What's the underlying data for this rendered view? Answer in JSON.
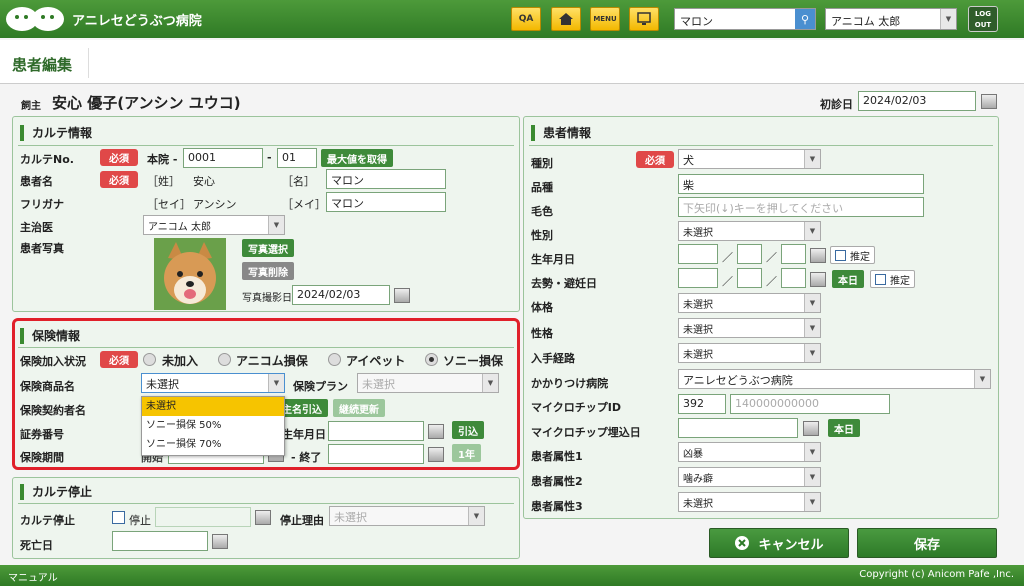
{
  "app": {
    "title": "アニレセどうぶつ病院",
    "search_value": "マロン",
    "user": "アニコム 太郎",
    "logout": "LOG OUT"
  },
  "toolbar": {
    "qa": "QA",
    "menu": "MENU"
  },
  "page": {
    "title": "患者編集"
  },
  "owner": {
    "label": "飼主",
    "name": "安心 優子(アンシン ユウコ)",
    "first_visit_label": "初診日",
    "first_visit": "2024/02/03"
  },
  "karte": {
    "title": "カルテ情報",
    "no_label": "カルテNo.",
    "required": "必須",
    "honin": "本院 -",
    "no1": "0001",
    "dash": "-",
    "no2": "01",
    "max_btn": "最大値を取得",
    "name_label": "患者名",
    "sei_lbl": "［姓］",
    "sei": "安心",
    "mei_lbl": "［名］",
    "mei": "マロン",
    "kana_label": "フリガナ",
    "sei_kana_lbl": "［セイ］",
    "sei_kana": "アンシン",
    "mei_kana_lbl": "［メイ］",
    "mei_kana": "マロン",
    "doctor_label": "主治医",
    "doctor": "アニコム 太郎",
    "photo_label": "患者写真",
    "photo_select": "写真選択",
    "photo_delete": "写真削除",
    "photo_date_label": "写真撮影日",
    "photo_date": "2024/02/03"
  },
  "insurance": {
    "title": "保険情報",
    "status_label": "保険加入状況",
    "required": "必須",
    "opt1": "未加入",
    "opt2": "アニコム損保",
    "opt3": "アイペット",
    "opt4": "ソニー損保",
    "product_label": "保険商品名",
    "product": "未選択",
    "plan_label": "保険プラン",
    "plan": "未選択",
    "holder_label": "保険契約者名",
    "owner_pull": "主名引込",
    "renew": "継続更新",
    "cert_label": "証券番号",
    "birth_label": "生年月日",
    "pull_btn": "引込",
    "period_label": "保険期間",
    "start_frag": "開始",
    "end_label": "- 終了",
    "year_btn": "1年",
    "dropdown": [
      "未選択",
      "ソニー損保 50%",
      "ソニー損保 70%"
    ]
  },
  "stop": {
    "title": "カルテ停止",
    "label": "カルテ停止",
    "checkbox": "停止",
    "reason_label": "停止理由",
    "reason": "未選択",
    "death_label": "死亡日"
  },
  "patient": {
    "title": "患者情報",
    "species_label": "種別",
    "required": "必須",
    "species": "犬",
    "breed_label": "品種",
    "breed": "柴",
    "color_label": "毛色",
    "color_ph": "下矢印(↓)キーを押してください",
    "sex_label": "性別",
    "sex": "未選択",
    "birth_label": "生年月日",
    "slash": "／",
    "estimate": "推定",
    "neuter_label": "去勢・避妊日",
    "today": "本日",
    "body_label": "体格",
    "body": "未選択",
    "temper_label": "性格",
    "temper": "未選択",
    "acq_label": "入手経路",
    "acq": "未選択",
    "clinic_label": "かかりつけ病院",
    "clinic": "アニレセどうぶつ病院",
    "chip_label": "マイクロチップID",
    "chip1": "392",
    "chip2_ph": "140000000000",
    "chipdate_label": "マイクロチップ埋込日",
    "attr1_label": "患者属性1",
    "attr1": "凶暴",
    "attr2_label": "患者属性2",
    "attr2": "噛み癖",
    "attr3_label": "患者属性3",
    "attr3": "未選択"
  },
  "actions": {
    "cancel": "キャンセル",
    "save": "保存"
  },
  "footer": {
    "manual": "マニュアル",
    "copyright": "Copyright (c) Anicom Pafe ,Inc."
  },
  "colors": {
    "brand_green": "#2f7a25",
    "required_red": "#e04848",
    "highlight": "#e0202a"
  }
}
